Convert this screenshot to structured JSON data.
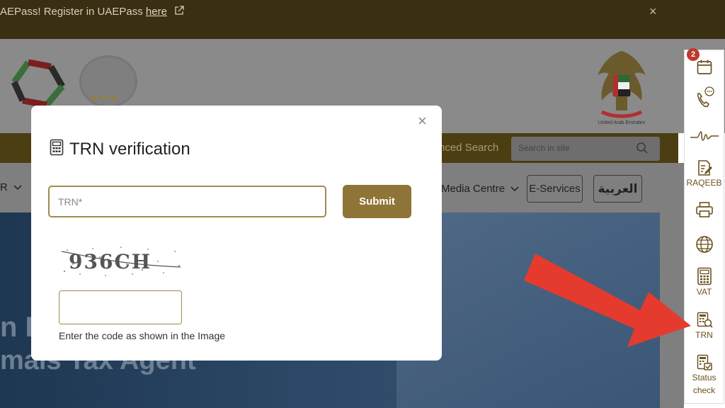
{
  "topbar": {
    "message": "AEPass! Register in UAEPass ",
    "link": "here",
    "close_glyph": "×"
  },
  "header": {
    "eagle_caption": "United Arab Emirates",
    "advanced_search": "nced Search",
    "search_placeholder": "Search in site"
  },
  "nav": {
    "menu_fragment": "R",
    "media_centre": "Media Centre",
    "eservices": "E-Services",
    "arabic": "العربية"
  },
  "hero": {
    "line1": "n F",
    "line2": "mais Tax Agent"
  },
  "modal": {
    "title": "TRN verification",
    "trn_placeholder": "TRN*",
    "trn_value": "",
    "submit_label": "Submit",
    "captcha_text": "936CH",
    "code_value": "",
    "code_hint": "Enter the code as shown in the Image",
    "close_glyph": "×"
  },
  "side_panel": {
    "badge_count": "2",
    "items": [
      {
        "icon": "calendar-icon",
        "label": ""
      },
      {
        "icon": "phone-chat-icon",
        "label": ""
      },
      {
        "icon": "signature-icon",
        "label": ""
      },
      {
        "icon": "raqeeb-icon",
        "label": "RAQEEB"
      },
      {
        "icon": "printer-icon",
        "label": ""
      },
      {
        "icon": "globe-icon",
        "label": ""
      },
      {
        "icon": "calculator-icon",
        "label": "VAT"
      },
      {
        "icon": "trn-icon",
        "label": "TRN"
      },
      {
        "icon": "status-icon",
        "label_line1": "Status",
        "label_line2": "check"
      }
    ]
  },
  "colors": {
    "brand_gold": "#8e7436",
    "topbar": "#3a2f12",
    "arrow_red": "#e53a2e",
    "badge": "#c0392b"
  }
}
